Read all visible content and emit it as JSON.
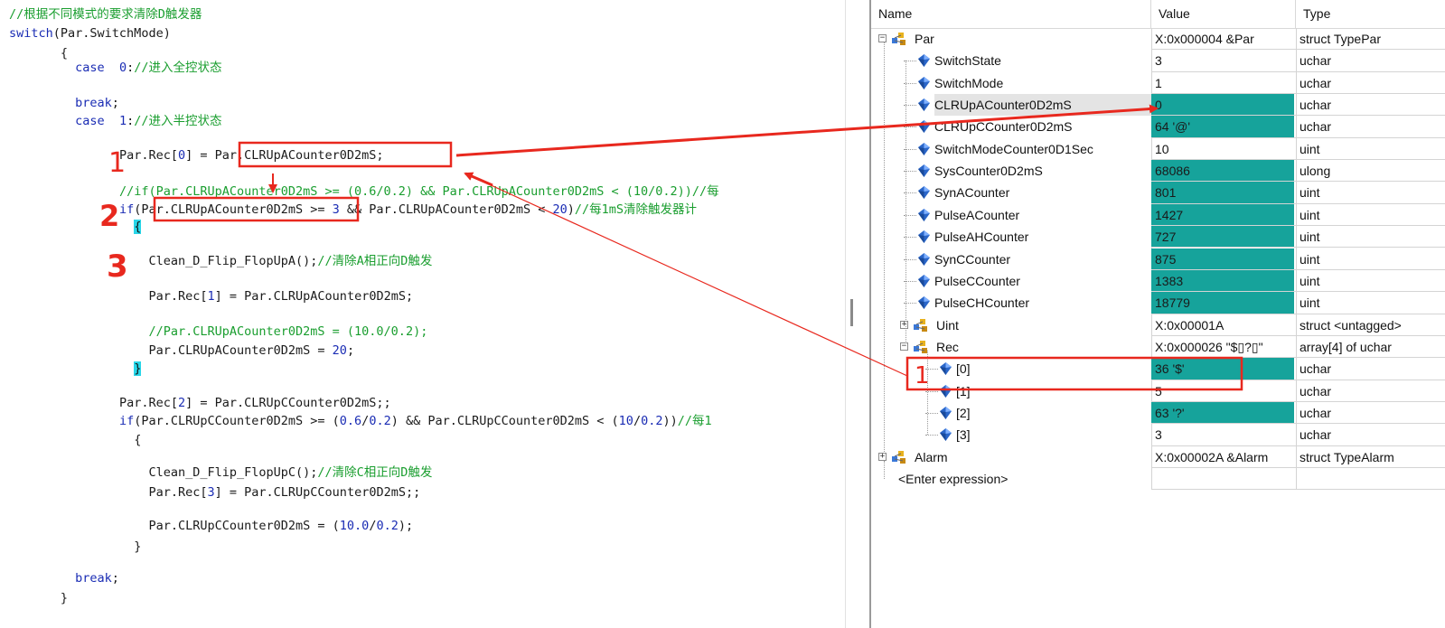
{
  "code": {
    "lines": [
      {
        "id": "c0",
        "indent": 0,
        "parts": [
          {
            "t": "cm",
            "s": "//根据不同模式的要求清除D触发器"
          }
        ]
      },
      {
        "id": "c1",
        "indent": 0,
        "parts": [
          {
            "t": "kw",
            "s": "switch"
          },
          {
            "t": "tx",
            "s": "(Par.SwitchMode)"
          }
        ]
      },
      {
        "id": "c2",
        "indent": 7,
        "parts": [
          {
            "t": "tx",
            "s": "{"
          }
        ]
      },
      {
        "id": "c3",
        "indent": 9,
        "parts": [
          {
            "t": "kw",
            "s": "case"
          },
          {
            "t": "tx",
            "s": "  "
          },
          {
            "t": "num",
            "s": "0"
          },
          {
            "t": "tx",
            "s": ":"
          },
          {
            "t": "cm",
            "s": "//进入全控状态"
          }
        ]
      },
      {
        "id": "c4",
        "indent": 9,
        "parts": [
          {
            "t": "kw",
            "s": "break"
          },
          {
            "t": "tx",
            "s": ";"
          }
        ]
      },
      {
        "id": "c5",
        "indent": 9,
        "parts": [
          {
            "t": "kw",
            "s": "case"
          },
          {
            "t": "tx",
            "s": "  "
          },
          {
            "t": "num",
            "s": "1"
          },
          {
            "t": "tx",
            "s": ":"
          },
          {
            "t": "cm",
            "s": "//进入半控状态"
          }
        ]
      },
      {
        "id": "c6",
        "indent": 15,
        "parts": [
          {
            "t": "tx",
            "s": "Par.Rec["
          },
          {
            "t": "num",
            "s": "0"
          },
          {
            "t": "tx",
            "s": "] = Par.CLRUpACounter0D2mS;"
          }
        ]
      },
      {
        "id": "c7",
        "indent": 15,
        "parts": [
          {
            "t": "cm",
            "s": "//if(Par.CLRUpACounter0D2mS >= (0.6/0.2) && Par.CLRUpACounter0D2mS < (10/0.2))//每"
          }
        ]
      },
      {
        "id": "c8",
        "indent": 15,
        "parts": [
          {
            "t": "kw",
            "s": "if"
          },
          {
            "t": "tx",
            "s": "(Par.CLRUpACounter0D2mS >= "
          },
          {
            "t": "num",
            "s": "3"
          },
          {
            "t": "tx",
            "s": " && Par.CLRUpACounter0D2mS < "
          },
          {
            "t": "num",
            "s": "20"
          },
          {
            "t": "tx",
            "s": ")"
          },
          {
            "t": "cm",
            "s": "//每1mS清除触发器计"
          }
        ]
      },
      {
        "id": "c9",
        "indent": 17,
        "parts": [
          {
            "t": "hl",
            "s": "{"
          }
        ]
      },
      {
        "id": "c10",
        "indent": 19,
        "parts": [
          {
            "t": "tx",
            "s": "Clean_D_Flip_FlopUpA();"
          },
          {
            "t": "cm",
            "s": "//清除A相正向D触发"
          }
        ]
      },
      {
        "id": "c11",
        "indent": 19,
        "parts": [
          {
            "t": "tx",
            "s": "Par.Rec["
          },
          {
            "t": "num",
            "s": "1"
          },
          {
            "t": "tx",
            "s": "] = Par.CLRUpACounter0D2mS;"
          }
        ]
      },
      {
        "id": "c12",
        "indent": 19,
        "parts": [
          {
            "t": "cm",
            "s": "//Par.CLRUpACounter0D2mS = (10.0/0.2);"
          }
        ]
      },
      {
        "id": "c13",
        "indent": 19,
        "parts": [
          {
            "t": "tx",
            "s": "Par.CLRUpACounter0D2mS = "
          },
          {
            "t": "num",
            "s": "20"
          },
          {
            "t": "tx",
            "s": ";"
          }
        ]
      },
      {
        "id": "c14",
        "indent": 17,
        "parts": [
          {
            "t": "hl",
            "s": "}"
          }
        ]
      },
      {
        "id": "c15",
        "indent": 15,
        "parts": [
          {
            "t": "tx",
            "s": "Par.Rec["
          },
          {
            "t": "num",
            "s": "2"
          },
          {
            "t": "tx",
            "s": "] = Par.CLRUpCCounter0D2mS;;"
          }
        ]
      },
      {
        "id": "c16",
        "indent": 15,
        "parts": [
          {
            "t": "kw",
            "s": "if"
          },
          {
            "t": "tx",
            "s": "(Par.CLRUpCCounter0D2mS >= ("
          },
          {
            "t": "num",
            "s": "0.6"
          },
          {
            "t": "tx",
            "s": "/"
          },
          {
            "t": "num",
            "s": "0.2"
          },
          {
            "t": "tx",
            "s": ") && Par.CLRUpCCounter0D2mS < ("
          },
          {
            "t": "num",
            "s": "10"
          },
          {
            "t": "tx",
            "s": "/"
          },
          {
            "t": "num",
            "s": "0.2"
          },
          {
            "t": "tx",
            "s": "))"
          },
          {
            "t": "cm",
            "s": "//每1"
          }
        ]
      },
      {
        "id": "c17",
        "indent": 17,
        "parts": [
          {
            "t": "tx",
            "s": "{"
          }
        ]
      },
      {
        "id": "c18",
        "indent": 19,
        "parts": [
          {
            "t": "tx",
            "s": "Clean_D_Flip_FlopUpC();"
          },
          {
            "t": "cm",
            "s": "//清除C相正向D触发"
          }
        ]
      },
      {
        "id": "c19",
        "indent": 19,
        "parts": [
          {
            "t": "tx",
            "s": "Par.Rec["
          },
          {
            "t": "num",
            "s": "3"
          },
          {
            "t": "tx",
            "s": "] = Par.CLRUpCCounter0D2mS;;"
          }
        ]
      },
      {
        "id": "c20",
        "indent": 19,
        "parts": [
          {
            "t": "tx",
            "s": "Par.CLRUpCCounter0D2mS = ("
          },
          {
            "t": "num",
            "s": "10.0"
          },
          {
            "t": "tx",
            "s": "/"
          },
          {
            "t": "num",
            "s": "0.2"
          },
          {
            "t": "tx",
            "s": ");"
          }
        ]
      },
      {
        "id": "c21",
        "indent": 17,
        "parts": [
          {
            "t": "tx",
            "s": "}"
          }
        ]
      },
      {
        "id": "c22",
        "indent": 9,
        "parts": [
          {
            "t": "kw",
            "s": "break"
          },
          {
            "t": "tx",
            "s": ";"
          }
        ]
      },
      {
        "id": "c23",
        "indent": 7,
        "parts": [
          {
            "t": "tx",
            "s": "}"
          }
        ]
      }
    ]
  },
  "watch": {
    "headers": {
      "name": "Name",
      "value": "Value",
      "type": "Type"
    },
    "rows": [
      {
        "level": 0,
        "expander": "minus",
        "icon": "struct-icon",
        "name": "Par",
        "value": "X:0x000004 &Par",
        "type": "struct TypePar",
        "changed": false
      },
      {
        "level": 1,
        "icon": "variable-gem-icon",
        "name": "SwitchState",
        "value": "3",
        "type": "uchar",
        "changed": false
      },
      {
        "level": 1,
        "icon": "variable-gem-icon",
        "name": "SwitchMode",
        "value": "1",
        "type": "uchar",
        "changed": false
      },
      {
        "level": 1,
        "icon": "variable-gem-icon",
        "name": "CLRUpACounter0D2mS",
        "value": "0",
        "type": "uchar",
        "changed": true,
        "selected": true
      },
      {
        "level": 1,
        "icon": "variable-gem-icon",
        "name": "CLRUpCCounter0D2mS",
        "value": "64 '@'",
        "type": "uchar",
        "changed": true
      },
      {
        "level": 1,
        "icon": "variable-gem-icon",
        "name": "SwitchModeCounter0D1Sec",
        "value": "10",
        "type": "uint",
        "changed": false
      },
      {
        "level": 1,
        "icon": "variable-gem-icon",
        "name": "SysCounter0D2mS",
        "value": "68086",
        "type": "ulong",
        "changed": true
      },
      {
        "level": 1,
        "icon": "variable-gem-icon",
        "name": "SynACounter",
        "value": "801",
        "type": "uint",
        "changed": true
      },
      {
        "level": 1,
        "icon": "variable-gem-icon",
        "name": "PulseACounter",
        "value": "1427",
        "type": "uint",
        "changed": true
      },
      {
        "level": 1,
        "icon": "variable-gem-icon",
        "name": "PulseAHCounter",
        "value": "727",
        "type": "uint",
        "changed": true
      },
      {
        "level": 1,
        "icon": "variable-gem-icon",
        "name": "SynCCounter",
        "value": "875",
        "type": "uint",
        "changed": true
      },
      {
        "level": 1,
        "icon": "variable-gem-icon",
        "name": "PulseCCounter",
        "value": "1383",
        "type": "uint",
        "changed": true
      },
      {
        "level": 1,
        "icon": "variable-gem-icon",
        "name": "PulseCHCounter",
        "value": "18779",
        "type": "uint",
        "changed": true
      },
      {
        "level": 1,
        "expander": "plus",
        "icon": "struct-icon",
        "name": "Uint",
        "value": "X:0x00001A",
        "type": "struct <untagged>",
        "changed": false
      },
      {
        "level": 1,
        "expander": "minus",
        "icon": "struct-icon",
        "name": "Rec",
        "value": "X:0x000026 \"$▯?▯\"",
        "type": "array[4] of uchar",
        "changed": false
      },
      {
        "level": 2,
        "icon": "variable-gem-icon",
        "name": "[0]",
        "value": "36 '$'",
        "type": "uchar",
        "changed": true
      },
      {
        "level": 2,
        "icon": "variable-gem-icon",
        "name": "[1]",
        "value": "5",
        "type": "uchar",
        "changed": false
      },
      {
        "level": 2,
        "icon": "variable-gem-icon",
        "name": "[2]",
        "value": "63 '?'",
        "type": "uchar",
        "changed": true
      },
      {
        "level": 2,
        "icon": "variable-gem-icon",
        "name": "[3]",
        "value": "3",
        "type": "uchar",
        "changed": false
      },
      {
        "level": 0,
        "expander": "plus",
        "icon": "struct-icon",
        "name": "Alarm",
        "value": "X:0x00002A &Alarm",
        "type": "struct TypeAlarm",
        "changed": false
      },
      {
        "level": 0,
        "icon": "none",
        "name": "<Enter expression>",
        "value": "",
        "type": "",
        "changed": false
      }
    ]
  },
  "annotations": {
    "marks": [
      "1",
      "2",
      "3",
      "1"
    ]
  },
  "colors": {
    "changed_value_bg": "#16a39b",
    "annotation_red": "#e8281e",
    "brace_highlight": "#28d6e8",
    "comment_green": "#1a9e2f",
    "keyword_blue": "#1a2cb4"
  }
}
